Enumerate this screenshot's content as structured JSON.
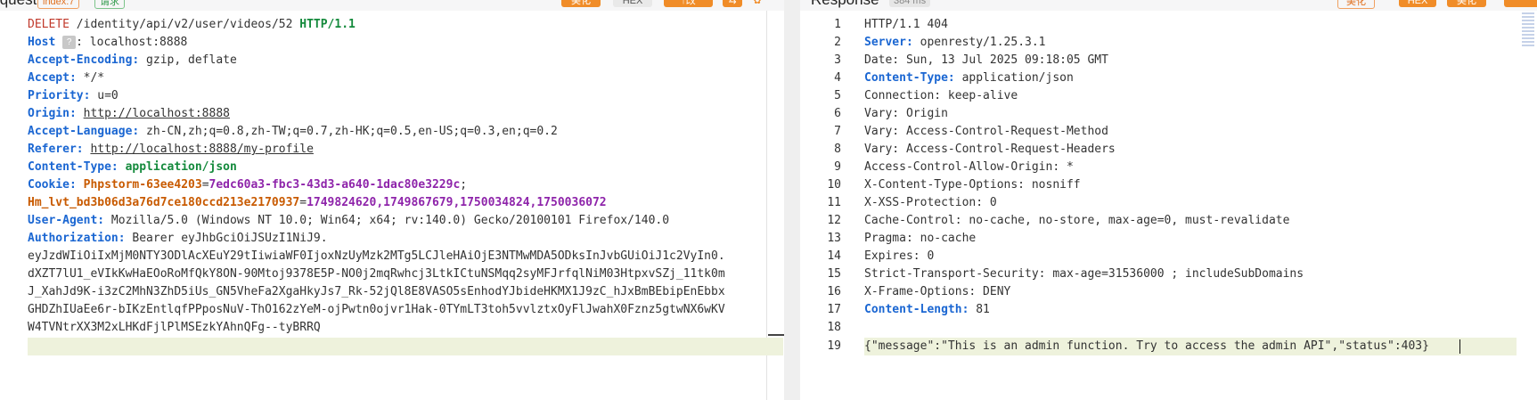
{
  "request_panel": {
    "title": "Request",
    "tag_primary": "index:7",
    "tag_secondary": "请求",
    "buttons": [
      "美化",
      "HEX",
      "↑改"
    ],
    "lines": {
      "l1": {
        "method": "DELETE",
        "path": " /identity/api/v2/user/videos/52 ",
        "protocol": "HTTP/1.1"
      },
      "l2": {
        "name": "Host",
        "badge": "?",
        "sep": ":",
        "value": " localhost:8888"
      },
      "l3": {
        "name": "Accept-Encoding:",
        "value": " gzip, deflate"
      },
      "l4": {
        "name": "Accept:",
        "value": " */*"
      },
      "l5": {
        "name": "Priority:",
        "value": " u=0"
      },
      "l6": {
        "name": "Origin:",
        "value": "http://localhost:8888"
      },
      "l7": {
        "name": "Accept-Language:",
        "value": " zh-CN,zh;q=0.8,zh-TW;q=0.7,zh-HK;q=0.5,en-US;q=0.3,en;q=0.2"
      },
      "l8": {
        "name": "Referer:",
        "value": "http://localhost:8888/my-profile"
      },
      "l9": {
        "name": "Content-Type:",
        "value": " application/json"
      },
      "l10": {
        "name": "Cookie:",
        "c1_name": " Phpstorm-63ee4203",
        "c1_eq": "=",
        "c1_val": "7edc60a3-fbc3-43d3-a640-1dac80e3229c",
        "sep": ";"
      },
      "l11": {
        "c2_name": "Hm_lvt_bd3b06d3a76d7ce180ccd213e2170937",
        "c2_eq": "=",
        "c2_val": "1749824620,1749867679,1750034824,1750036072"
      },
      "l12": {
        "name": "User-Agent:",
        "value": " Mozilla/5.0 (Windows NT 10.0; Win64; x64; rv:140.0) Gecko/20100101 Firefox/140.0"
      },
      "l13": {
        "name": "Authorization:",
        "value": " Bearer eyJhbGciOiJSUzI1NiJ9."
      },
      "l14": "eyJzdWIiOiIxMjM0NTY3ODlAcXEuY29tIiwiaWF0IjoxNzUyMzk2MTg5LCJleHAiOjE3NTMwMDA5ODksInJvbGUiOiJ1c2VyIn0.",
      "l15": "dXZT7lU1_eVIkKwHaEOoRoMfQkY8ON-90Mtoj9378E5P-NO0j2mqRwhcj3LtkICtuNSMqq2syMFJrfqlNiM03HtpxvSZj_11tk0m",
      "l16": "J_XahJd9K-i3zC2MhN3ZhD5iUs_GN5VheFa2XgaHkyJs7_Rk-52jQl8E8VASO5sEnhodYJbideHKMX1J9zC_hJxBmBEbipEnEbbx",
      "l17": "GHDZhIUaEe6r-bIKzEntlqfPPposNuV-ThO162zYeM-ojPwtn0ojvr1Hak-0TYmLT3toh5vvlztxOyFlJwahX0Fznz5gtwNX6wKV",
      "l18": "W4TVNtrXX3M2xLHKdFjlPlMSEzkYAhnQFg--tyBRRQ"
    }
  },
  "response_panel": {
    "title": "Response",
    "time_badge": "384 ms",
    "buttons": [
      "美化",
      "HEX",
      "美化"
    ],
    "line_numbers": [
      "1",
      "2",
      "3",
      "4",
      "5",
      "6",
      "7",
      "8",
      "9",
      "10",
      "11",
      "12",
      "13",
      "14",
      "15",
      "16",
      "17",
      "18",
      "19"
    ],
    "lines": {
      "r1": {
        "value": "HTTP/1.1 404"
      },
      "r2": {
        "name": "Server:",
        "value": " openresty/1.25.3.1"
      },
      "r3": {
        "value": "Date: Sun, 13 Jul 2025 09:18:05 GMT"
      },
      "r4": {
        "name": "Content-Type:",
        "value": " application/json"
      },
      "r5": {
        "value": "Connection: keep-alive"
      },
      "r6": {
        "value": "Vary: Origin"
      },
      "r7": {
        "value": "Vary: Access-Control-Request-Method"
      },
      "r8": {
        "value": "Vary: Access-Control-Request-Headers"
      },
      "r9": {
        "value": "Access-Control-Allow-Origin: *"
      },
      "r10": {
        "value": "X-Content-Type-Options: nosniff"
      },
      "r11": {
        "value": "X-XSS-Protection: 0"
      },
      "r12": {
        "value": "Cache-Control: no-cache, no-store, max-age=0, must-revalidate"
      },
      "r13": {
        "value": "Pragma: no-cache"
      },
      "r14": {
        "value": "Expires: 0"
      },
      "r15": {
        "value": "Strict-Transport-Security: max-age=31536000 ; includeSubDomains"
      },
      "r16": {
        "value": "X-Frame-Options: DENY"
      },
      "r17": {
        "name": "Content-Length:",
        "value": " 81"
      },
      "r18": {
        "value": ""
      },
      "r19": {
        "value": "{\"message\":\"This is an admin function. Try to access the admin API\",\"status\":403}"
      }
    }
  },
  "colors": {
    "header_name": "#1a66d2",
    "method": "#c0392b",
    "protocol": "#148a3c",
    "cookie_name": "#c85a00",
    "cookie_value": "#8e24aa",
    "accent_orange": "#f08c28",
    "highlight_line": "#eef2dc"
  }
}
